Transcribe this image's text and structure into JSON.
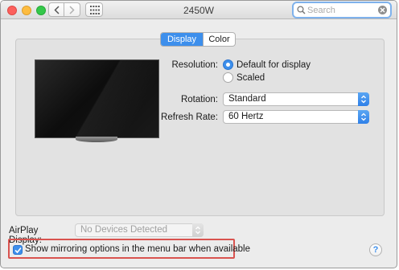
{
  "window": {
    "title": "2450W"
  },
  "search": {
    "placeholder": "Search",
    "value": ""
  },
  "tabs": [
    {
      "label": "Display",
      "selected": true
    },
    {
      "label": "Color",
      "selected": false
    }
  ],
  "resolution": {
    "label": "Resolution:",
    "options": [
      {
        "label": "Default for display",
        "selected": true
      },
      {
        "label": "Scaled",
        "selected": false
      }
    ]
  },
  "rotation": {
    "label": "Rotation:",
    "value": "Standard"
  },
  "refresh_rate": {
    "label": "Refresh Rate:",
    "value": "60 Hertz"
  },
  "airplay": {
    "label": "AirPlay Display:",
    "value": "No Devices Detected",
    "enabled": false
  },
  "mirroring": {
    "label": "Show mirroring options in the menu bar when available",
    "checked": true
  },
  "help": {
    "label": "?"
  },
  "colors": {
    "accent": "#3d8fec",
    "highlight_box": "#d9534f"
  }
}
